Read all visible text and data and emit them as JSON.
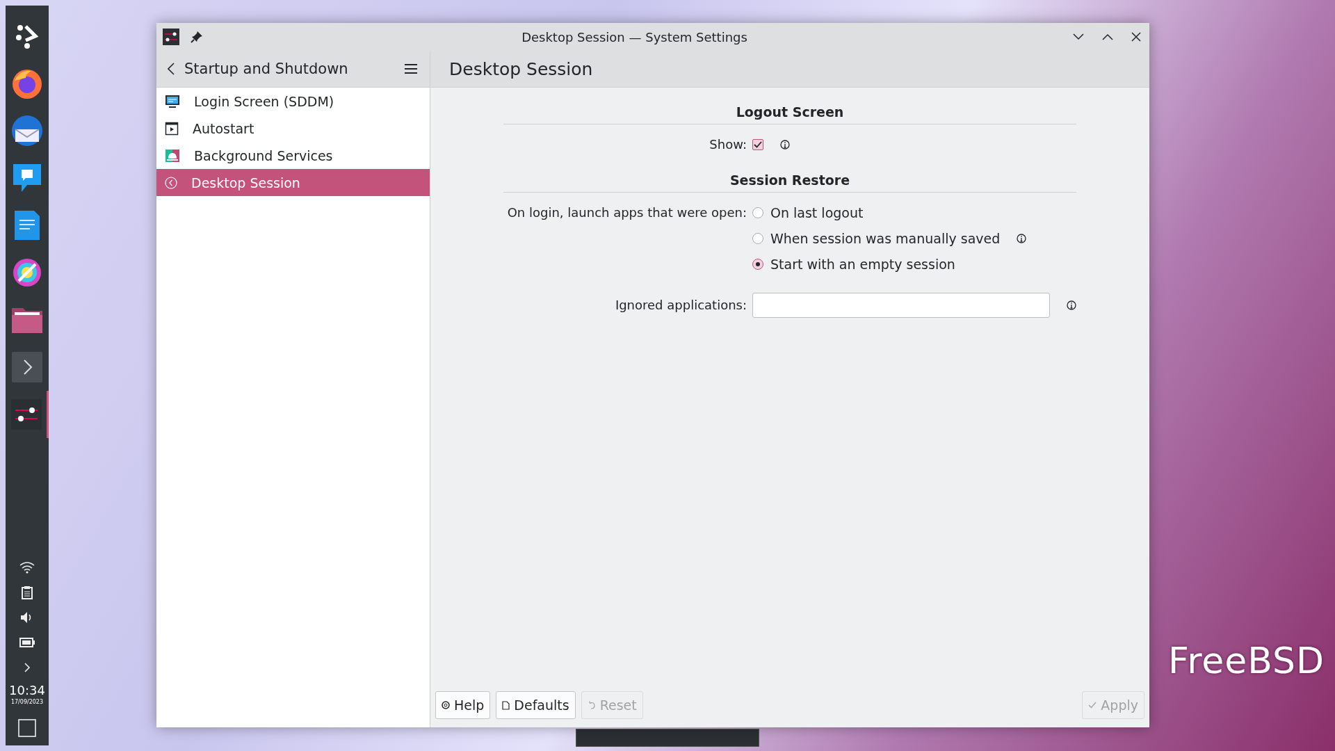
{
  "taskbar": {
    "launchers": [
      {
        "kind": "menu",
        "active": false
      },
      {
        "kind": "firefox",
        "active": false
      },
      {
        "kind": "mail",
        "active": false
      },
      {
        "kind": "chat",
        "active": false
      },
      {
        "kind": "document",
        "active": false
      },
      {
        "kind": "paint",
        "active": false
      },
      {
        "kind": "folder",
        "active": false
      },
      {
        "kind": "terminal",
        "active": false
      },
      {
        "kind": "settings",
        "active": true
      }
    ],
    "tray": [
      {
        "kind": "wifi"
      },
      {
        "kind": "clipboard"
      },
      {
        "kind": "volume"
      },
      {
        "kind": "battery"
      },
      {
        "kind": "expand"
      }
    ],
    "clock": {
      "time": "10:34",
      "date": "17/09/2023"
    }
  },
  "wallpaper": {
    "logo": "FreeBSD"
  },
  "window": {
    "title": "Desktop Session — System Settings",
    "sidebar": {
      "header": "Startup and Shutdown",
      "items": [
        {
          "label": "Login Screen (SDDM)",
          "kind": "monitor",
          "selected": false
        },
        {
          "label": "Autostart",
          "kind": "play",
          "selected": false
        },
        {
          "label": "Background Services",
          "kind": "services",
          "selected": false
        },
        {
          "label": "Desktop Session",
          "kind": "session",
          "selected": true
        }
      ]
    },
    "page": {
      "title": "Desktop Session",
      "logout": {
        "title": "Logout Screen",
        "label": "Show:",
        "checked": true
      },
      "restore": {
        "title": "Session Restore",
        "label": "On login, launch apps that were open:",
        "options": [
          {
            "label": "On last logout",
            "selected": false,
            "info": false
          },
          {
            "label": "When session was manually saved",
            "selected": false,
            "info": true
          },
          {
            "label": "Start with an empty session",
            "selected": true,
            "info": false
          }
        ],
        "ignored_label": "Ignored applications:"
      }
    },
    "buttons": [
      {
        "label": "Help",
        "kind": "help",
        "disabled": false
      },
      {
        "label": "Defaults",
        "kind": "defaults",
        "disabled": false
      },
      {
        "label": "Reset",
        "kind": "reset",
        "disabled": true
      },
      {
        "label": "Apply",
        "kind": "apply",
        "disabled": true
      }
    ]
  }
}
